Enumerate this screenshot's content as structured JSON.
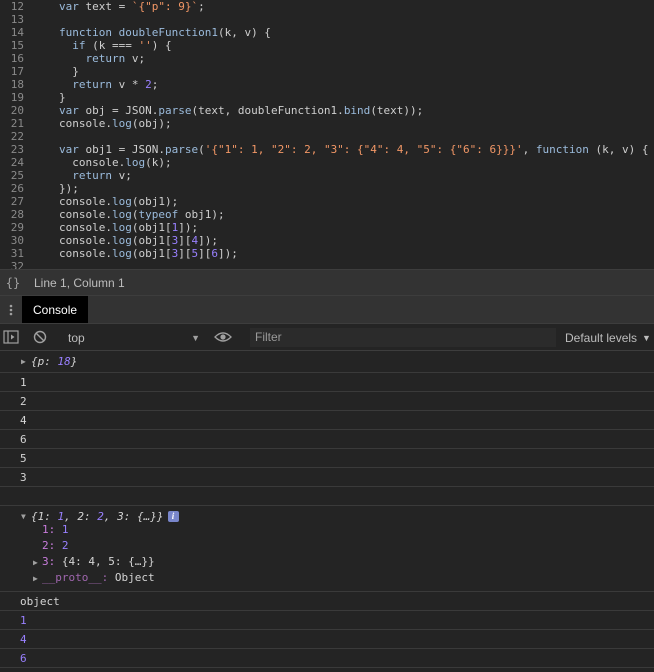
{
  "editor": {
    "lines": [
      {
        "n": "12",
        "t": [
          [
            "kw",
            "var "
          ],
          [
            "pl",
            "text = "
          ],
          [
            "str",
            "`{\"p\": 9}`"
          ],
          [
            "pl",
            ";"
          ]
        ]
      },
      {
        "n": "13",
        "t": []
      },
      {
        "n": "14",
        "t": [
          [
            "kw",
            "function "
          ],
          [
            "fn",
            "doubleFunction1"
          ],
          [
            "pl",
            "(k, v) {"
          ]
        ]
      },
      {
        "n": "15",
        "t": [
          [
            "pl",
            "  "
          ],
          [
            "kw",
            "if "
          ],
          [
            "pl",
            "(k === "
          ],
          [
            "str",
            "''"
          ],
          [
            "pl",
            ") {"
          ]
        ]
      },
      {
        "n": "16",
        "t": [
          [
            "pl",
            "    "
          ],
          [
            "kw",
            "return "
          ],
          [
            "pl",
            "v;"
          ]
        ]
      },
      {
        "n": "17",
        "t": [
          [
            "pl",
            "  }"
          ]
        ]
      },
      {
        "n": "18",
        "t": [
          [
            "pl",
            "  "
          ],
          [
            "kw",
            "return "
          ],
          [
            "pl",
            "v * "
          ],
          [
            "num",
            "2"
          ],
          [
            "pl",
            ";"
          ]
        ]
      },
      {
        "n": "19",
        "t": [
          [
            "pl",
            "}"
          ]
        ]
      },
      {
        "n": "20",
        "t": [
          [
            "kw",
            "var "
          ],
          [
            "pl",
            "obj = JSON."
          ],
          [
            "fn",
            "parse"
          ],
          [
            "pl",
            "(text, doubleFunction1."
          ],
          [
            "fn",
            "bind"
          ],
          [
            "pl",
            "(text));"
          ]
        ]
      },
      {
        "n": "21",
        "t": [
          [
            "pl",
            "console."
          ],
          [
            "fn",
            "log"
          ],
          [
            "pl",
            "(obj);"
          ]
        ]
      },
      {
        "n": "22",
        "t": []
      },
      {
        "n": "23",
        "t": [
          [
            "kw",
            "var "
          ],
          [
            "pl",
            "obj1 = JSON."
          ],
          [
            "fn",
            "parse"
          ],
          [
            "pl",
            "("
          ],
          [
            "str",
            "'{\"1\": 1, \"2\": 2, \"3\": {\"4\": 4, \"5\": {\"6\": 6}}}'"
          ],
          [
            "pl",
            ", "
          ],
          [
            "kw",
            "function "
          ],
          [
            "pl",
            "(k, v) {"
          ]
        ]
      },
      {
        "n": "24",
        "t": [
          [
            "pl",
            "  console."
          ],
          [
            "fn",
            "log"
          ],
          [
            "pl",
            "(k);"
          ]
        ]
      },
      {
        "n": "25",
        "t": [
          [
            "pl",
            "  "
          ],
          [
            "kw",
            "return "
          ],
          [
            "pl",
            "v;"
          ]
        ]
      },
      {
        "n": "26",
        "t": [
          [
            "pl",
            "});"
          ]
        ]
      },
      {
        "n": "27",
        "t": [
          [
            "pl",
            "console."
          ],
          [
            "fn",
            "log"
          ],
          [
            "pl",
            "(obj1);"
          ]
        ]
      },
      {
        "n": "28",
        "t": [
          [
            "pl",
            "console."
          ],
          [
            "fn",
            "log"
          ],
          [
            "pl",
            "("
          ],
          [
            "kw",
            "typeof "
          ],
          [
            "pl",
            "obj1);"
          ]
        ]
      },
      {
        "n": "29",
        "t": [
          [
            "pl",
            "console."
          ],
          [
            "fn",
            "log"
          ],
          [
            "pl",
            "(obj1["
          ],
          [
            "num",
            "1"
          ],
          [
            "pl",
            "]);"
          ]
        ]
      },
      {
        "n": "30",
        "t": [
          [
            "pl",
            "console."
          ],
          [
            "fn",
            "log"
          ],
          [
            "pl",
            "(obj1["
          ],
          [
            "num",
            "3"
          ],
          [
            "pl",
            "]["
          ],
          [
            "num",
            "4"
          ],
          [
            "pl",
            "]);"
          ]
        ]
      },
      {
        "n": "31",
        "t": [
          [
            "pl",
            "console."
          ],
          [
            "fn",
            "log"
          ],
          [
            "pl",
            "(obj1["
          ],
          [
            "num",
            "3"
          ],
          [
            "pl",
            "]["
          ],
          [
            "num",
            "5"
          ],
          [
            "pl",
            "]["
          ],
          [
            "num",
            "6"
          ],
          [
            "pl",
            "]);"
          ]
        ]
      },
      {
        "n": "32",
        "t": []
      }
    ]
  },
  "status_bar": {
    "braces_icon": "{}",
    "cursor_position": "Line 1, Column 1"
  },
  "tabs": {
    "menu_icon": "kebab-menu-icon",
    "active_tab": "Console"
  },
  "toolbar": {
    "context": "top",
    "filter_placeholder": "Filter",
    "levels": "Default levels"
  },
  "console": {
    "obj_preview": {
      "open": "{",
      "key": "p",
      "sep": ": ",
      "value": "18",
      "close": "}"
    },
    "key_logs": [
      "1",
      "2",
      "4",
      "6",
      "5",
      "3"
    ],
    "obj1_preview": {
      "open": "{",
      "k1": "1",
      "v1": "1",
      "k2": "2",
      "v2": "2",
      "k3": "3",
      "v3": "{…}",
      "close": "}",
      "info_badge": "i"
    },
    "obj1_props": [
      {
        "key": "1",
        "value": "1"
      },
      {
        "key": "2",
        "value": "2"
      }
    ],
    "obj1_nested": {
      "key": "3",
      "preview": "{4: 4, 5: {…}}"
    },
    "proto": {
      "key": "__proto__",
      "value": "Object"
    },
    "typeof_result": "object",
    "values": [
      "1",
      "4",
      "6"
    ]
  },
  "colors": {
    "background": "#242424",
    "keyword": "#9bbbdc",
    "string": "#f29766",
    "number": "#9980ff",
    "property_key": "#c87cdc"
  }
}
